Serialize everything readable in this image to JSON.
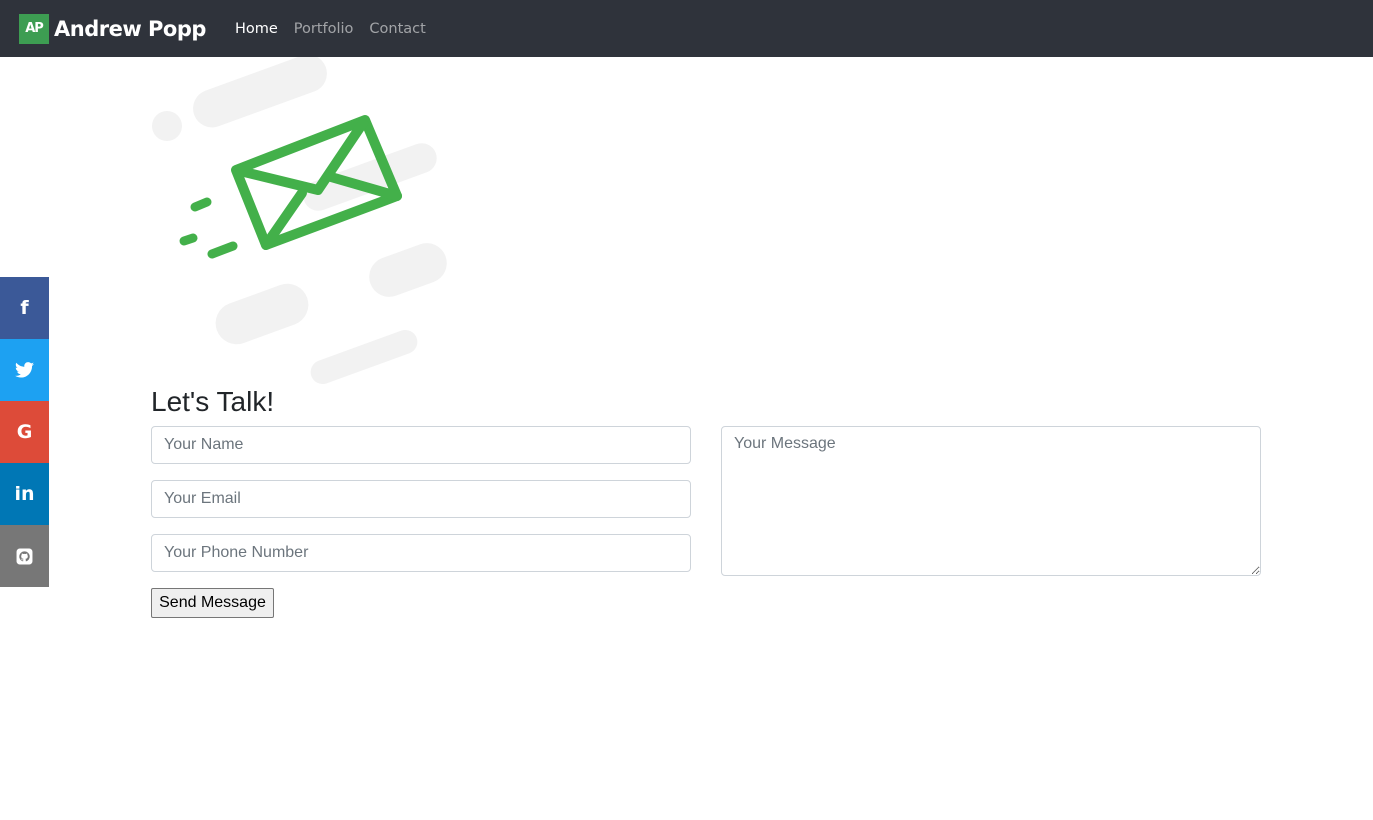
{
  "navbar": {
    "logo_text": "AP",
    "brand_name": "Andrew Popp",
    "links": [
      {
        "label": "Home",
        "active": true
      },
      {
        "label": "Portfolio",
        "active": false
      },
      {
        "label": "Contact",
        "active": false
      }
    ]
  },
  "social": [
    {
      "name": "facebook",
      "icon": "facebook-icon",
      "glyph": "f",
      "color": "#3b5998"
    },
    {
      "name": "twitter",
      "icon": "twitter-icon",
      "color": "#1da1f2"
    },
    {
      "name": "google",
      "icon": "google-icon",
      "glyph": "G",
      "color": "#dd4b39"
    },
    {
      "name": "linkedin",
      "icon": "linkedin-icon",
      "glyph": "in",
      "color": "#0077b5"
    },
    {
      "name": "github",
      "icon": "github-icon",
      "color": "#777777"
    }
  ],
  "illustration": {
    "icon": "envelope-icon",
    "accent_color": "#43b04a"
  },
  "contact": {
    "heading": "Let's Talk!",
    "name_placeholder": "Your Name",
    "email_placeholder": "Your Email",
    "phone_placeholder": "Your Phone Number",
    "message_placeholder": "Your Message",
    "send_label": "Send Message"
  }
}
